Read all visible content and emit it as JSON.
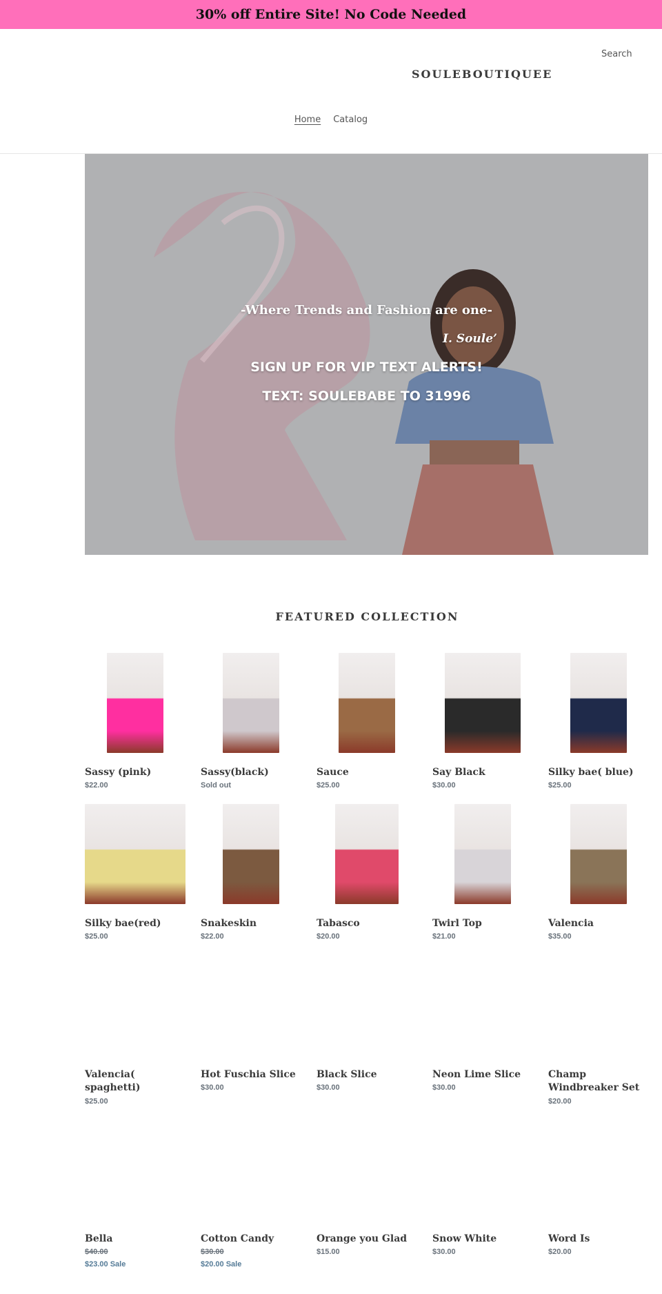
{
  "announcement": {
    "text": "30% off Entire Site! No Code Needed"
  },
  "header": {
    "search_label": "Search",
    "logo": "SOULEBOUTIQUEE",
    "nav": [
      {
        "label": "Home",
        "active": true
      },
      {
        "label": "Catalog",
        "active": false
      }
    ]
  },
  "hero": {
    "quote": "-Where Trends and Fashion are one-",
    "author": "I. Soule’",
    "signup": "SIGN UP FOR VIP TEXT ALERTS!",
    "text_code": "TEXT: SOULEBABE TO 31996"
  },
  "featured": {
    "title": "FEATURED COLLECTION",
    "products": [
      {
        "name": "Sassy (pink)",
        "price": "$22.00"
      },
      {
        "name": "Sassy(black)",
        "price": "Sold out"
      },
      {
        "name": "Sauce",
        "price": "$25.00"
      },
      {
        "name": "Say Black",
        "price": "$30.00"
      },
      {
        "name": "Silky bae( blue)",
        "price": "$25.00"
      },
      {
        "name": "Silky bae(red)",
        "price": "$25.00"
      },
      {
        "name": "Snakeskin",
        "price": "$22.00"
      },
      {
        "name": "Tabasco",
        "price": "$20.00"
      },
      {
        "name": "Twirl Top",
        "price": "$21.00"
      },
      {
        "name": "Valencia",
        "price": "$35.00"
      },
      {
        "name": "Valencia( spaghetti)",
        "price": "$25.00"
      },
      {
        "name": "Hot Fuschia Slice",
        "price": "$30.00"
      },
      {
        "name": "Black Slice",
        "price": "$30.00"
      },
      {
        "name": "Neon Lime Slice",
        "price": "$30.00"
      },
      {
        "name": "Champ Windbreaker Set",
        "price": "$20.00"
      },
      {
        "name": "Bella",
        "price": "$40.00",
        "sale_price": "$23.00 Sale"
      },
      {
        "name": "Cotton Candy",
        "price": "$30.00",
        "sale_price": "$20.00 Sale"
      },
      {
        "name": "Orange you Glad",
        "price": "$15.00"
      },
      {
        "name": "Snow White",
        "price": "$30.00"
      },
      {
        "name": "Word Is",
        "price": "$20.00"
      }
    ]
  }
}
